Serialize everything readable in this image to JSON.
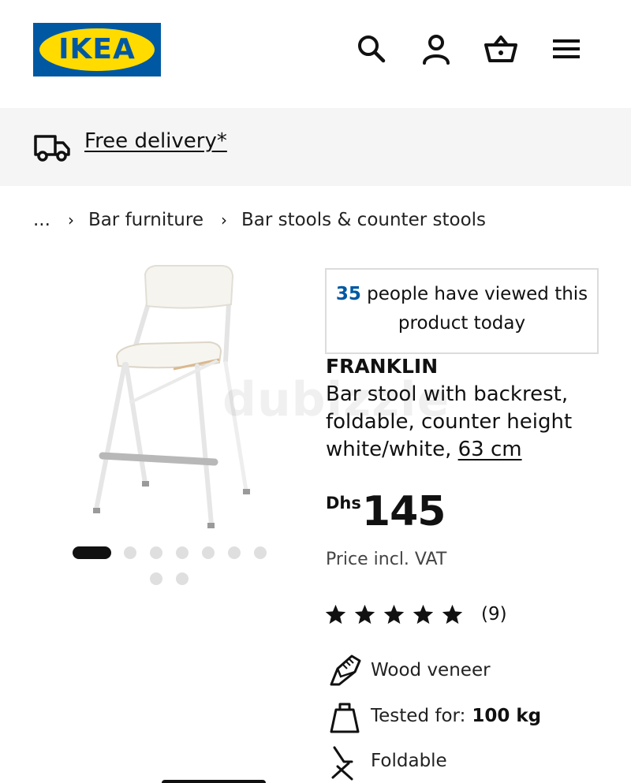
{
  "header": {
    "logo_text": "IKEA",
    "icons": [
      "search-icon",
      "account-icon",
      "basket-icon",
      "menu-icon"
    ]
  },
  "banner": {
    "delivery_label": "Free delivery*"
  },
  "breadcrumb": {
    "ellipsis": "...",
    "separator": "›",
    "items": [
      "Bar furniture",
      "Bar stools & counter stools"
    ]
  },
  "carousel": {
    "image_count": 9,
    "active_index": 0
  },
  "watermark": "dubizzle",
  "viewed": {
    "count": "35",
    "text": " people have viewed this product today"
  },
  "product": {
    "name": "FRANKLIN",
    "description": "Bar stool with backrest, foldable, counter height white/white, ",
    "size": "63 cm",
    "currency": "Dhs",
    "price": "145",
    "vat_note": "Price incl. VAT",
    "rating": 5,
    "review_count": "(9)"
  },
  "features": [
    {
      "icon": "wood-veneer-icon",
      "label": "Wood veneer",
      "value": ""
    },
    {
      "icon": "weight-icon",
      "label": "Tested for:",
      "value": " 100 kg"
    },
    {
      "icon": "foldable-chair-icon",
      "label": "Foldable",
      "value": ""
    }
  ],
  "colors": {
    "ikea_blue": "#0058a3",
    "ikea_yellow": "#ffdb00",
    "banner_bg": "#f5f5f5"
  }
}
